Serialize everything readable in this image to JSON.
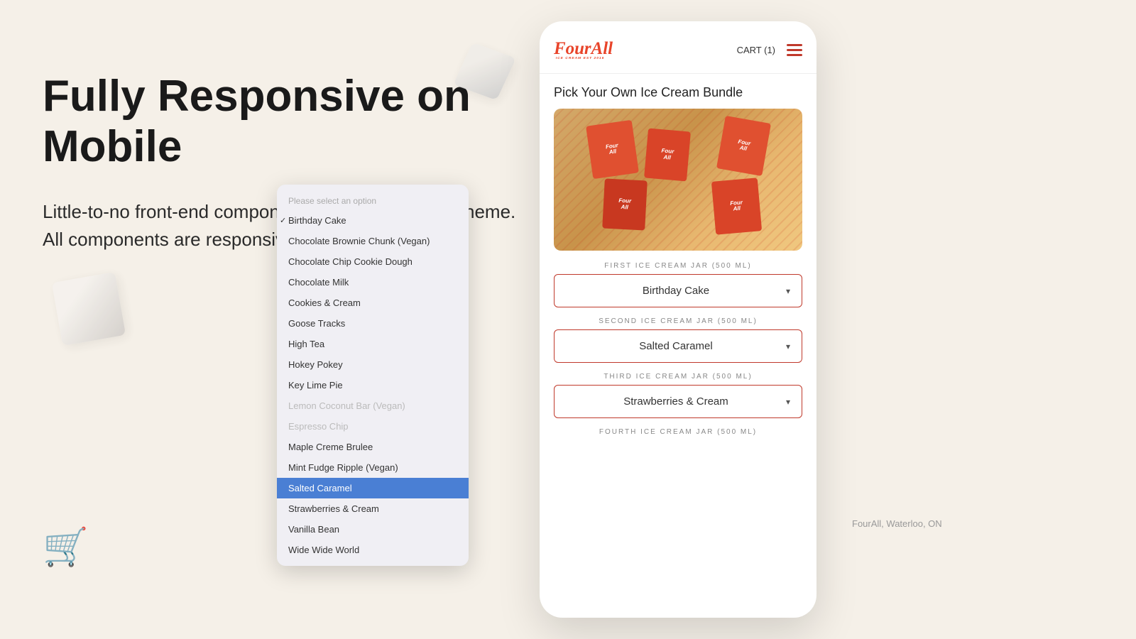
{
  "page": {
    "background": "#f5f0e8"
  },
  "left": {
    "heading": "Fully Responsive on Mobile",
    "subtext": "Little-to-no front-end components required on your theme. All components are responsive and customizable."
  },
  "phone": {
    "brand": "FourAll",
    "brand_sub": "ICE CREAM EST 2016",
    "cart_label": "CART (1)",
    "product_title": "Pick Your Own Ice Cream Bundle",
    "jar1_label": "FIRST ICE CREAM JAR (500 ML)",
    "jar2_label": "SECOND ICE CREAM JAR (500 ML)",
    "jar3_label": "THIRD ICE CREAM JAR (500 ML)",
    "jar4_label": "FOURTH ICE CREAM JAR (500 ML)",
    "select1_value": "Birthday Cake",
    "select2_value": "Salted Caramel",
    "select3_value": "Strawberries & Cream"
  },
  "dropdown": {
    "header": "Please select an option",
    "items": [
      {
        "label": "Birthday Cake",
        "state": "checked"
      },
      {
        "label": "Chocolate Brownie Chunk (Vegan)",
        "state": "normal"
      },
      {
        "label": "Chocolate Chip Cookie Dough",
        "state": "normal"
      },
      {
        "label": "Chocolate Milk",
        "state": "normal"
      },
      {
        "label": "Cookies & Cream",
        "state": "normal"
      },
      {
        "label": "Goose Tracks",
        "state": "normal"
      },
      {
        "label": "High Tea",
        "state": "normal"
      },
      {
        "label": "Hokey Pokey",
        "state": "normal"
      },
      {
        "label": "Key Lime Pie",
        "state": "normal"
      },
      {
        "label": "Lemon Coconut Bar (Vegan)",
        "state": "disabled"
      },
      {
        "label": "Espresso Chip",
        "state": "disabled"
      },
      {
        "label": "Maple Creme Brulee",
        "state": "normal"
      },
      {
        "label": "Mint Fudge Ripple (Vegan)",
        "state": "normal"
      },
      {
        "label": "Salted Caramel",
        "state": "selected"
      },
      {
        "label": "Strawberries & Cream",
        "state": "normal"
      },
      {
        "label": "Vanilla Bean",
        "state": "normal"
      },
      {
        "label": "Wide Wide World",
        "state": "normal"
      }
    ]
  },
  "footer": {
    "location": "FourAll, Waterloo, ON"
  }
}
